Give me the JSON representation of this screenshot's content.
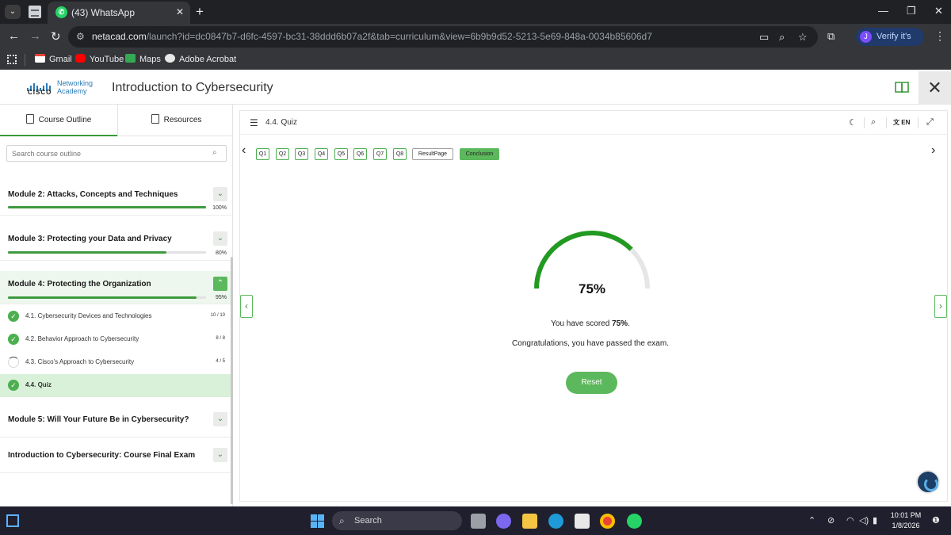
{
  "browser": {
    "tab_title": "(43) WhatsApp",
    "url_host": "netacad.com",
    "url_rest": "/launch?id=dc0847b7-d6fc-4597-bc31-38ddd6b07a2f&tab=curriculum&view=6b9b9d52-5213-5e69-848a-0034b85606d7",
    "profile_label": "Verify it's you",
    "profile_initial": "J",
    "bookmarks": [
      "Gmail",
      "YouTube",
      "Maps",
      "Adobe Acrobat"
    ]
  },
  "app": {
    "logo_brand": "CISCO",
    "logo_line1": "Networking",
    "logo_line2": "Academy",
    "course_title": "Introduction to Cybersecurity"
  },
  "sidebar": {
    "tabs": [
      "Course Outline",
      "Resources"
    ],
    "search_placeholder": "Search course outline",
    "modules": [
      {
        "title": "Module 2: Attacks, Concepts and Techniques",
        "progress_pct": 100,
        "progress_label": "100%"
      },
      {
        "title": "Module 3: Protecting your Data and Privacy",
        "progress_pct": 80,
        "progress_label": "80%"
      },
      {
        "title": "Module 4: Protecting the Organization",
        "progress_pct": 95,
        "progress_label": "95%"
      },
      {
        "title": "Module 5: Will Your Future Be in Cybersecurity?"
      },
      {
        "title": "Introduction to Cybersecurity: Course Final Exam"
      }
    ],
    "lessons": [
      {
        "title": "4.1. Cybersecurity Devices and Technologies",
        "count": "10 / 10",
        "status": "complete"
      },
      {
        "title": "4.2. Behavior Approach to Cybersecurity",
        "count": "8 / 8",
        "status": "complete"
      },
      {
        "title": "4.3. Cisco's Approach to Cybersecurity",
        "count": "4 / 5",
        "status": "partial"
      },
      {
        "title": "4.4. Quiz",
        "count": "",
        "status": "complete"
      }
    ]
  },
  "main": {
    "title": "4.4. Quiz",
    "lang": "EN",
    "question_buttons": [
      "Q1",
      "Q2",
      "Q3",
      "Q4",
      "Q5",
      "Q6",
      "Q7",
      "Q8"
    ],
    "result_page_label": "ResultPage",
    "conclusion_label": "Conclusion",
    "score_fraction": 0.75,
    "score_pct_label": "75%",
    "score_prefix": "You have scored ",
    "score_value": "75%",
    "score_suffix": ".",
    "congrats_text": "Congratulations, you have passed the exam.",
    "reset_label": "Reset"
  },
  "taskbar": {
    "search_label": "Search",
    "time": "10:01 PM",
    "date": "1/8/2026"
  },
  "colors": {
    "accent_green": "#5cb85c",
    "gauge_green": "#229a22",
    "gauge_track": "#e6e6e6"
  }
}
